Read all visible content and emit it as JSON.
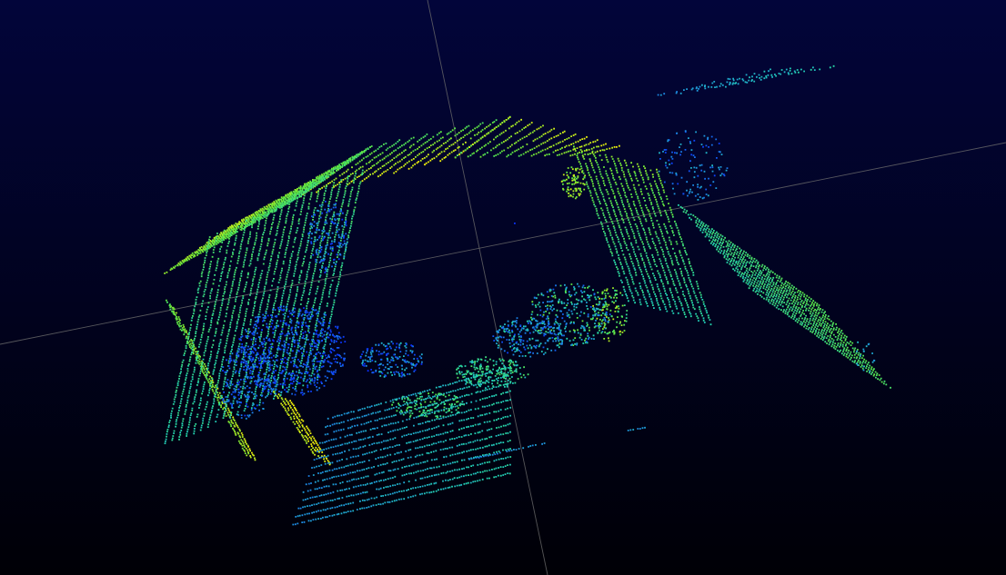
{
  "viewer": {
    "background_top": "#02053a",
    "background_bottom": "#000006",
    "grid_color": "#6b6b6b"
  },
  "colormap": {
    "low": "#0a2cff",
    "mid_low": "#1e8fe0",
    "mid": "#23d6b0",
    "mid_high": "#5fe840",
    "high": "#f4f20a"
  }
}
